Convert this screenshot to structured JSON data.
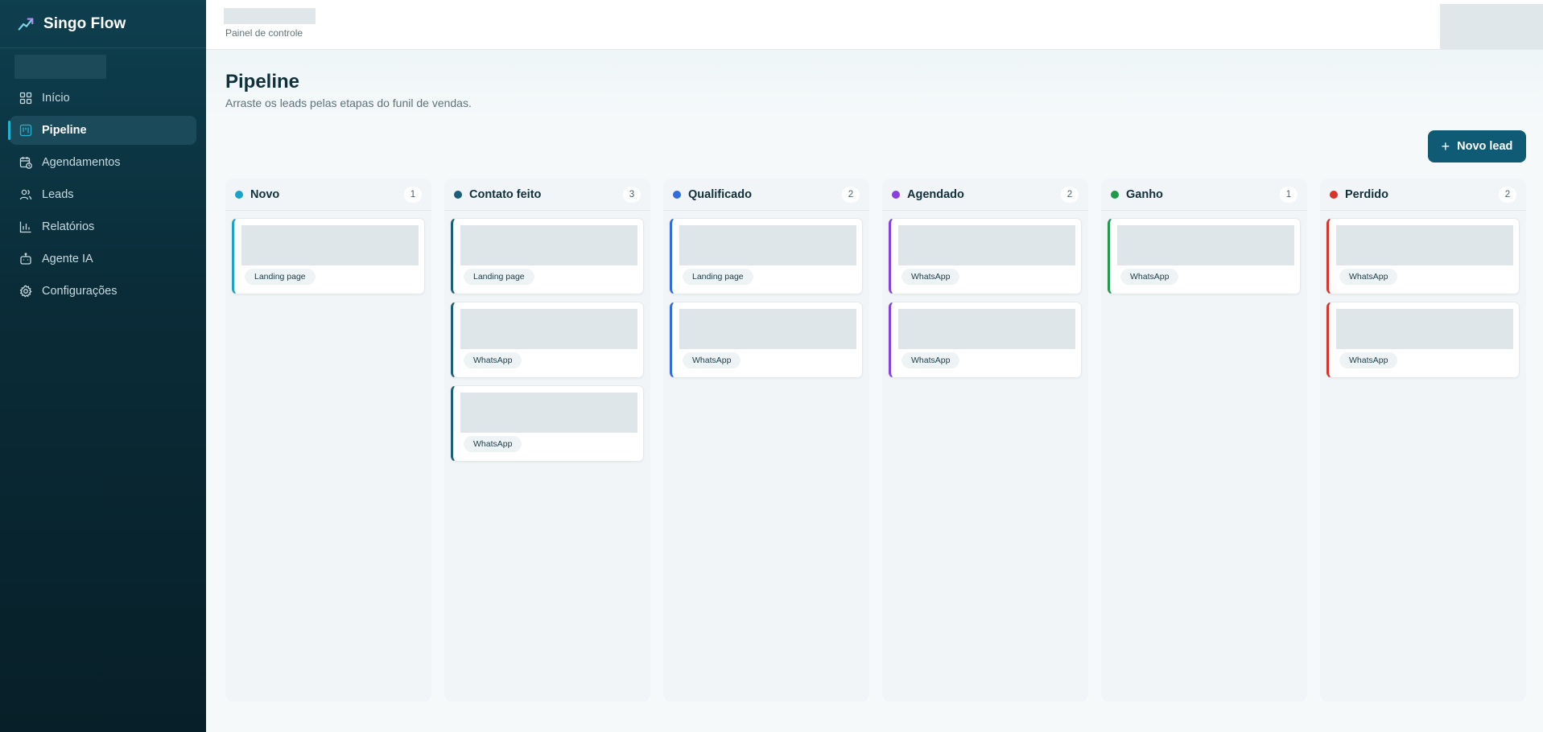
{
  "brand": {
    "name": "Singo Flow",
    "icon": "trend-icon"
  },
  "sidebar": {
    "items": [
      {
        "label": "Início",
        "icon": "grid-icon",
        "active": false
      },
      {
        "label": "Pipeline",
        "icon": "kanban-icon",
        "active": true
      },
      {
        "label": "Agendamentos",
        "icon": "calendar-clock-icon",
        "active": false
      },
      {
        "label": "Leads",
        "icon": "users-icon",
        "active": false
      },
      {
        "label": "Relatórios",
        "icon": "bar-chart-icon",
        "active": false
      },
      {
        "label": "Agente IA",
        "icon": "bot-icon",
        "active": false
      },
      {
        "label": "Configurações",
        "icon": "gear-icon",
        "active": false
      }
    ]
  },
  "header": {
    "breadcrumb": "Painel de controle"
  },
  "page": {
    "title": "Pipeline",
    "subtitle": "Arraste os leads pelas etapas do funil de vendas.",
    "new_lead_label": "Novo lead"
  },
  "colors": {
    "accent": "#0f5a74",
    "sidebar_bg": "#0a2c38"
  },
  "columns": [
    {
      "title": "Novo",
      "count": "1",
      "color": "#1aa3c8",
      "cards": [
        {
          "tag": "Landing page"
        }
      ]
    },
    {
      "title": "Contato feito",
      "count": "3",
      "color": "#1a5f78",
      "cards": [
        {
          "tag": "Landing page"
        },
        {
          "tag": "WhatsApp"
        },
        {
          "tag": "WhatsApp"
        }
      ]
    },
    {
      "title": "Qualificado",
      "count": "2",
      "color": "#2f6de0",
      "cards": [
        {
          "tag": "Landing page"
        },
        {
          "tag": "WhatsApp"
        }
      ]
    },
    {
      "title": "Agendado",
      "count": "2",
      "color": "#8a3fe0",
      "cards": [
        {
          "tag": "WhatsApp"
        },
        {
          "tag": "WhatsApp"
        }
      ]
    },
    {
      "title": "Ganho",
      "count": "1",
      "color": "#1f9a48",
      "cards": [
        {
          "tag": "WhatsApp"
        }
      ]
    },
    {
      "title": "Perdido",
      "count": "2",
      "color": "#d9332b",
      "cards": [
        {
          "tag": "WhatsApp"
        },
        {
          "tag": "WhatsApp"
        }
      ]
    }
  ]
}
